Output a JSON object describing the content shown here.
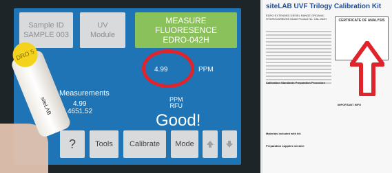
{
  "device": {
    "tiles": {
      "sample_id_line1": "Sample ID",
      "sample_id_line2": "SAMPLE 003",
      "uv_line1": "UV",
      "uv_line2": "Module",
      "measure_line1": "MEASURE FLUORESENCE",
      "measure_line2": "EDRO-042H"
    },
    "reading": {
      "value": "4.99",
      "unit": "PPM"
    },
    "measurements": {
      "label": "Measurements",
      "value1": "4.99",
      "value2": "4651.52",
      "unit1": "PPM",
      "unit2": "RFU"
    },
    "status": "Good!",
    "buttons": {
      "help": "?",
      "tools": "Tools",
      "calibrate": "Calibrate",
      "mode": "Mode"
    },
    "vial_cap_text": "DRO 5",
    "vial_label_text": "siteLAB"
  },
  "document": {
    "title": "siteLAB UVF Trilogy Calibration Kit",
    "subtitle": "EDRO EXTENDED DIESEL RANGE ORGANIC HYDROCARBONS Model Product No. CAL-042H",
    "box_title": "CERTIFICATE OF ANALYSIS",
    "section1": "Calibration Standards Preparation Procedure",
    "section2": "Materials included with kit:",
    "section3": "Preparation supplies needed:",
    "section4": "IMPORTANT INFO"
  },
  "colors": {
    "screen_bg": "#1f74b6",
    "measure_tile": "#8bc15a",
    "highlight": "#e0242b",
    "brand_blue": "#1e4fa0"
  }
}
